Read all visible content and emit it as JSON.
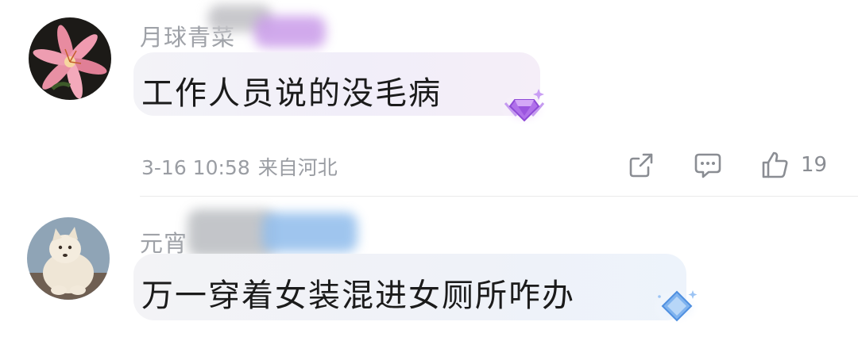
{
  "comments": [
    {
      "username": "月球青菜",
      "text": "工作人员说的没毛病",
      "date": "3-16 10:58",
      "location": "来自河北",
      "likes": "19",
      "badge_color": "#a45ce8",
      "avatar": "pink-lily-avatar"
    },
    {
      "username": "元宵",
      "text": "万一穿着女装混进女厕所咋办",
      "badge_color": "#6aa2f0",
      "avatar": "white-dog-avatar"
    }
  ],
  "icons": {
    "share": "share-icon",
    "reply": "comment-icon",
    "like": "thumbs-up-icon"
  }
}
